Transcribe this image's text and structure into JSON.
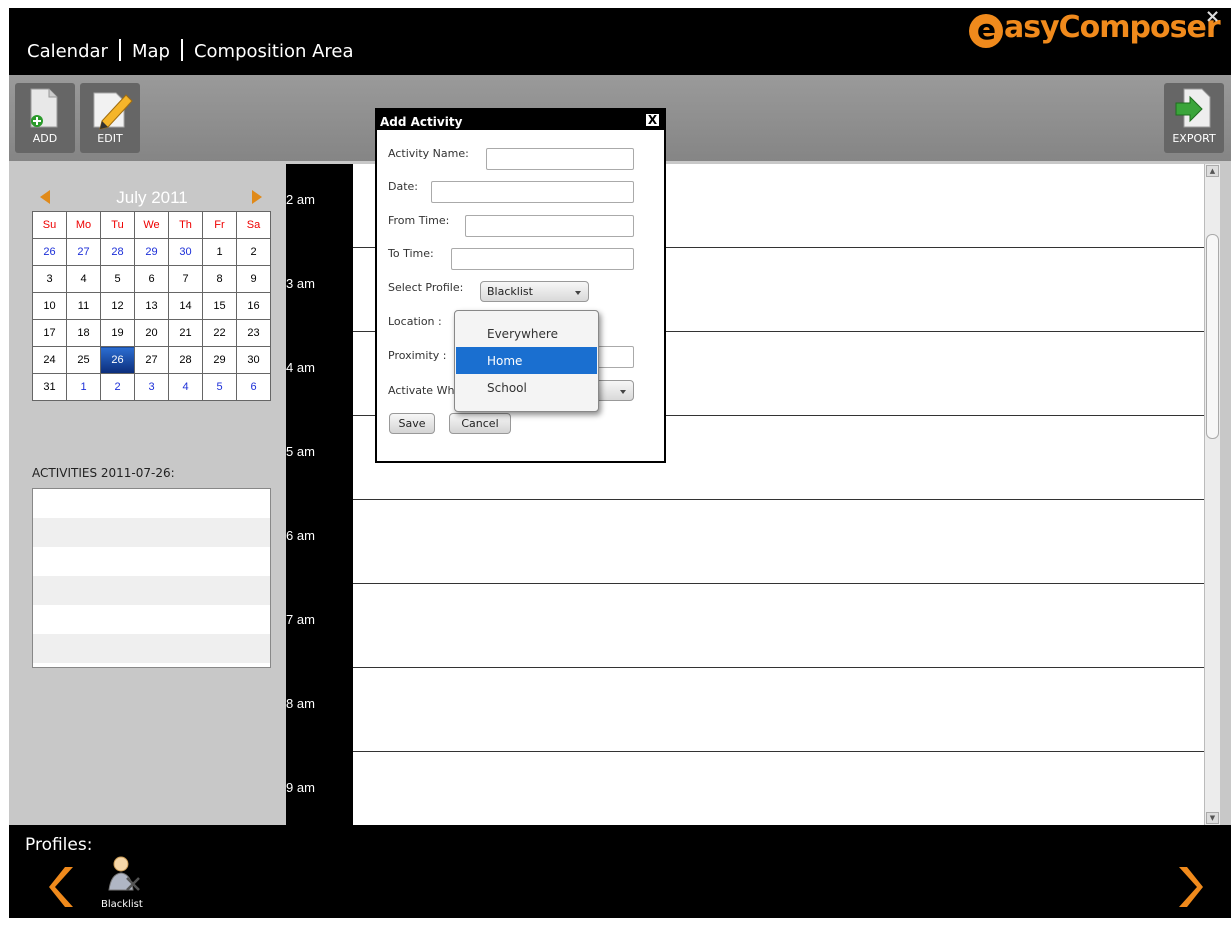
{
  "header": {
    "nav": [
      "Calendar",
      "Map",
      "Composition Area"
    ],
    "logo": "asyComposer",
    "logo_letter": "e",
    "close_label": "×"
  },
  "toolbar": {
    "add_label": "ADD",
    "edit_label": "EDIT",
    "export_label": "EXPORT"
  },
  "calendar": {
    "month_label": "July 2011",
    "weekdays": [
      "Su",
      "Mo",
      "Tu",
      "We",
      "Th",
      "Fr",
      "Sa"
    ],
    "weeks": [
      [
        "26",
        "27",
        "28",
        "29",
        "30",
        "1",
        "2"
      ],
      [
        "3",
        "4",
        "5",
        "6",
        "7",
        "8",
        "9"
      ],
      [
        "10",
        "11",
        "12",
        "13",
        "14",
        "15",
        "16"
      ],
      [
        "17",
        "18",
        "19",
        "20",
        "21",
        "22",
        "23"
      ],
      [
        "24",
        "25",
        "26",
        "27",
        "28",
        "29",
        "30"
      ],
      [
        "31",
        "1",
        "2",
        "3",
        "4",
        "5",
        "6"
      ]
    ],
    "selected_day": "26"
  },
  "activities": {
    "label": "ACTIVITIES 2011-07-26:",
    "items": []
  },
  "schedule": {
    "times": [
      "2 am",
      "3 am",
      "4 am",
      "5 am",
      "6 am",
      "7 am",
      "8 am",
      "9 am"
    ]
  },
  "dialog": {
    "title": "Add Activity",
    "close": "X",
    "activity_name_label": "Activity Name:",
    "activity_name_value": "",
    "date_label": "Date:",
    "date_value": "",
    "from_time_label": "From Time:",
    "from_time_value": "",
    "to_time_label": "To Time:",
    "to_time_value": "",
    "select_profile_label": "Select Profile:",
    "profile_selected": "Blacklist",
    "location_label": "Location :",
    "proximity_label": "Proximity :",
    "activate_label": "Activate Wh",
    "save_label": "Save",
    "cancel_label": "Cancel"
  },
  "location_dropdown": {
    "options": [
      "Everywhere",
      "Home",
      "School"
    ],
    "highlighted": "Home"
  },
  "footer": {
    "profiles_label": "Profiles:",
    "profile_name": "Blacklist"
  },
  "colors": {
    "accent_orange": "#f08a1c",
    "selection_blue": "#1a6fd0"
  }
}
